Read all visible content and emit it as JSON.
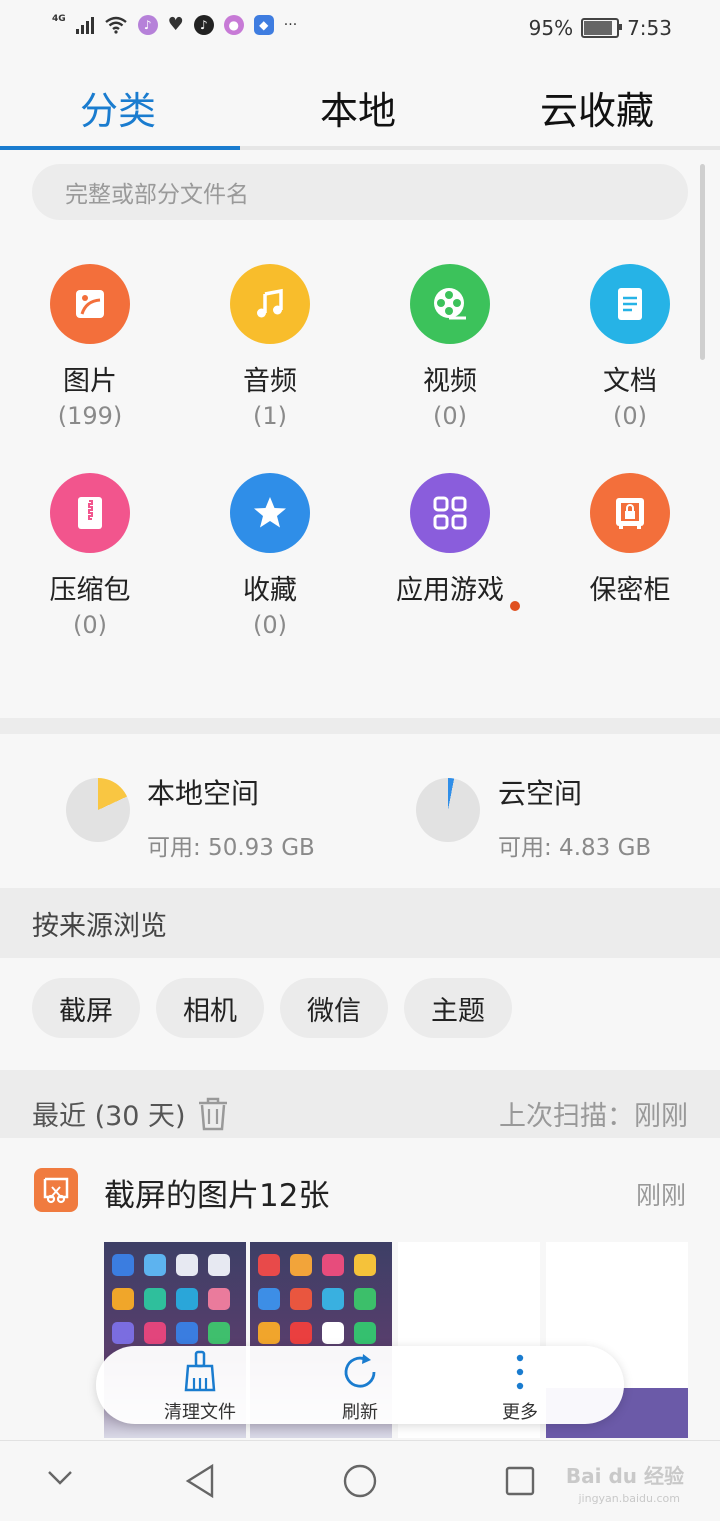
{
  "status_bar": {
    "network": "4G",
    "battery_percent": "95%",
    "time": "7:53",
    "more": "···"
  },
  "tabs": [
    {
      "label": "分类",
      "active": true
    },
    {
      "label": "本地",
      "active": false
    },
    {
      "label": "云收藏",
      "active": false
    }
  ],
  "search": {
    "placeholder": "完整或部分文件名"
  },
  "categories": [
    {
      "label": "图片",
      "count": "(199)",
      "color": "#f36f3b",
      "icon": "image-icon"
    },
    {
      "label": "音频",
      "count": "(1)",
      "color": "#f8bd2c",
      "icon": "music-icon"
    },
    {
      "label": "视频",
      "count": "(0)",
      "color": "#3cc25b",
      "icon": "film-reel-icon"
    },
    {
      "label": "文档",
      "count": "(0)",
      "color": "#26b3e6",
      "icon": "document-icon"
    },
    {
      "label": "压缩包",
      "count": "(0)",
      "color": "#f2558d",
      "icon": "zip-icon"
    },
    {
      "label": "收藏",
      "count": "(0)",
      "color": "#2f8ee8",
      "icon": "star-icon"
    },
    {
      "label": "应用游戏",
      "count": "",
      "color": "#8a5ddc",
      "icon": "apps-grid-icon"
    },
    {
      "label": "保密柜",
      "count": "",
      "color": "#f36f3b",
      "icon": "safe-icon"
    }
  ],
  "storage": {
    "local": {
      "title": "本地空间",
      "available": "可用: 50.93 GB",
      "used_fraction": 0.18,
      "color": "#f9c642"
    },
    "cloud": {
      "title": "云空间",
      "available": "可用: 4.83 GB",
      "used_fraction": 0.03,
      "color": "#2f8ee8"
    }
  },
  "browse_by_source": {
    "title": "按来源浏览",
    "chips": [
      "截屏",
      "相机",
      "微信",
      "主题"
    ]
  },
  "recent": {
    "title": "最近 (30 天)",
    "last_scan": "上次扫描：刚刚"
  },
  "screenshot_group": {
    "title": "截屏的图片12张",
    "time": "刚刚"
  },
  "bottom_actions": [
    {
      "label": "清理文件",
      "icon": "broom-icon"
    },
    {
      "label": "刷新",
      "icon": "refresh-icon"
    },
    {
      "label": "更多",
      "icon": "more-vertical-icon"
    }
  ],
  "watermark": {
    "line1": "Bai du 经验",
    "line2": "jingyan.baidu.com"
  }
}
